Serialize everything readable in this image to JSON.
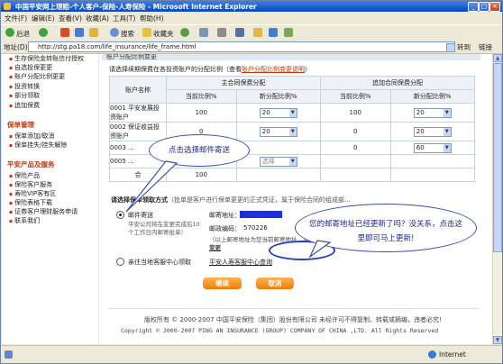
{
  "window": {
    "title": "中国平安网上理赔-个人客户-保险-人寿保险 - Microsoft Internet Explorer",
    "min": "_",
    "max": "□",
    "close": "×"
  },
  "menu": [
    "文件(F)",
    "编辑(E)",
    "查看(V)",
    "收藏(A)",
    "工具(T)",
    "帮助(H)"
  ],
  "toolbar": {
    "back": "后退",
    "search": "搜索",
    "favorites": "收藏夹"
  },
  "address": {
    "label": "地址(D)",
    "url": "http://stg.pa18.com/life_insurance/life_frame.html",
    "go": "转到",
    "links": "链接"
  },
  "sidebar": {
    "items_top": [
      "生存保险金转账信付授权",
      "自选投保更更",
      "账户分配比例更更",
      "投资转换",
      "部分领取",
      "追加保费"
    ],
    "head1": "保单管理",
    "items_mid": [
      "保单添加/取消",
      "保单挂失/挂失解除"
    ],
    "head2": "平安产品及服务",
    "items_bot": [
      "保险产品",
      "保险客户服务",
      "寿险VIP客有区",
      "保险表格下载",
      "证券客户理财服务申请",
      "联系我们"
    ]
  },
  "main": {
    "panel_title": "账户分配比例变更",
    "desc_prefix": "请选择续期保费在各投资账户的分配比例（查看",
    "desc_link": "账户分配比例变更说明",
    "desc_suffix": "）",
    "table": {
      "col_account": "账户名称",
      "group_main": "主合同保费分配",
      "group_add": "追加合同保费分配",
      "current": "当前比例%",
      "new": "新分配比例%",
      "rows": [
        {
          "name": "0001 平安发展投资账户",
          "cur1": "100",
          "new1": "20",
          "cur2": "100",
          "new2": "20"
        },
        {
          "name": "0002 保证收益投资账户",
          "cur1": "0",
          "new1": "20",
          "cur2": "0",
          "new2": "20"
        },
        {
          "name": "0003 ...",
          "cur1": "",
          "new1": "",
          "cur2": "0",
          "new2": "60"
        },
        {
          "name": "0005 ...",
          "cur1": "",
          "new1": "选择",
          "cur2": "",
          "new2": ""
        }
      ],
      "total_label": "合",
      "total_value": "100"
    },
    "delivery": {
      "label": "请选择保单领取方式",
      "hint": "（批单是客户进行保单更更的正式凭证，属于保险合同的组成部...",
      "opt1_label": "邮件寄送",
      "opt1_sub": "平安公司将在变更完成后10个工作日内邮寄批单）",
      "addr_label": "邮寄地址：",
      "zip_label": "邮政编码：",
      "zip_value": "570226",
      "note": "（以上邮寄地址为您当前邮寄地址，本系统地址。如果您已更换了新的地址，建议您先修改",
      "update_link": "地址变更",
      "opt2_label": "亲往当地客服中心领取",
      "opt2_link": "平安人寿客服中心查询"
    },
    "continue": "继续",
    "cancel": "取消",
    "footer_cn": "版权所有 © 2000-2007 中国平安保险（集团）股份有限公司 未经许可不得复制、转载或摘编，违者必究!",
    "footer_en": "Copyright © 2000-2007 PING AN INSURANCE (GROUP) COMPANY OF CHINA ,LTD. All Rights Reserved"
  },
  "callouts": {
    "mail": "点击选择邮件寄送",
    "address": "您的邮寄地址已经更新了吗？没关系，点击这里即可马上更新!"
  },
  "status": {
    "zone": "Internet"
  }
}
